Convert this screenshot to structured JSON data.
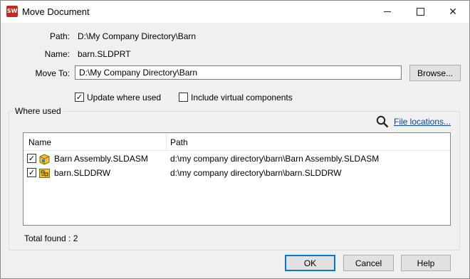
{
  "window": {
    "title": "Move Document",
    "app_icon_text": "SW"
  },
  "fields": {
    "path_label": "Path:",
    "path_value": "D:\\My Company Directory\\Barn",
    "name_label": "Name:",
    "name_value": "barn.SLDPRT",
    "move_to_label": "Move To:",
    "move_to_value": "D:\\My Company Directory\\Barn",
    "browse_label": "Browse..."
  },
  "options": {
    "update_where_used": {
      "label": "Update where used",
      "checked": true
    },
    "include_virtual": {
      "label": "Include virtual components",
      "checked": false
    }
  },
  "where_used": {
    "title": "Where used",
    "file_locations_link": "File locations...",
    "columns": {
      "name": "Name",
      "path": "Path"
    },
    "rows": [
      {
        "checked": true,
        "icon": "assembly-icon",
        "name": "Barn Assembly.SLDASM",
        "path": "d:\\my company directory\\barn\\Barn Assembly.SLDASM"
      },
      {
        "checked": true,
        "icon": "drawing-icon",
        "name": "barn.SLDDRW",
        "path": "d:\\my company directory\\barn\\barn.SLDDRW"
      }
    ],
    "total_found": "Total found : 2"
  },
  "buttons": {
    "ok": "OK",
    "cancel": "Cancel",
    "help": "Help"
  }
}
